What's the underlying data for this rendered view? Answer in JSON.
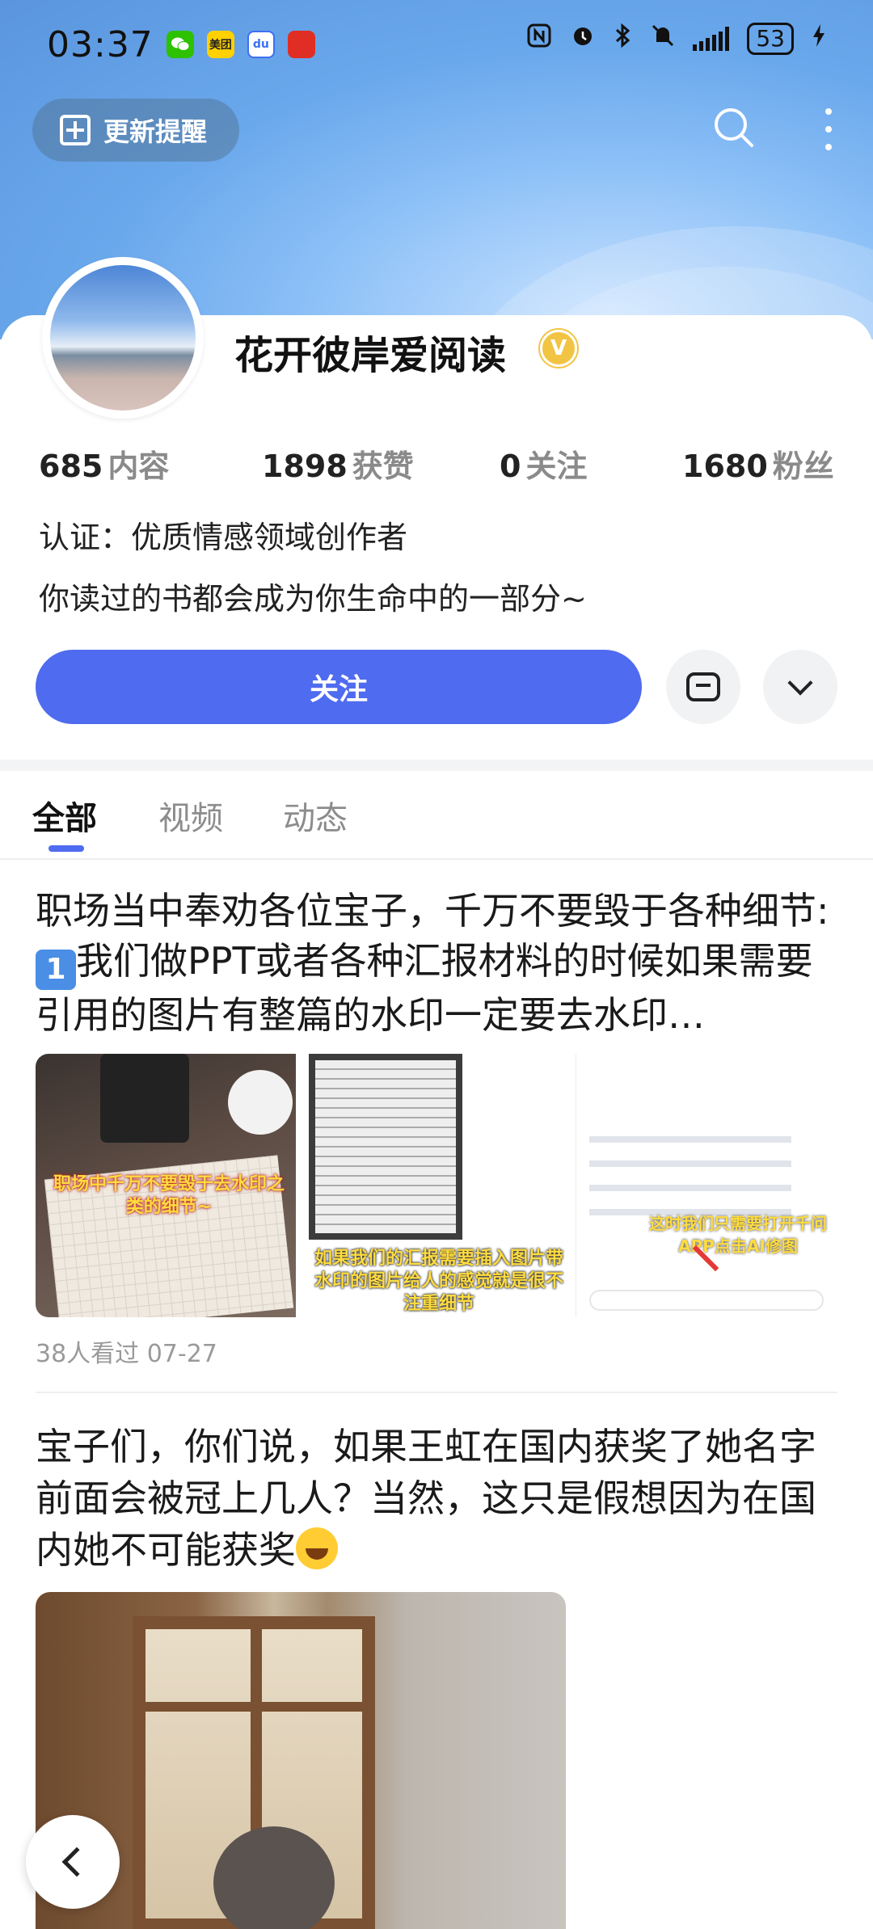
{
  "status_bar": {
    "time": "03:37",
    "app_icons": [
      {
        "name": "wechat-icon",
        "label": "",
        "color": "#2dc100"
      },
      {
        "name": "meituan-icon",
        "label": "美团",
        "color": "#ffd100"
      },
      {
        "name": "baidu-icon",
        "label": "du",
        "color": "#3b6ff5"
      },
      {
        "name": "pinduoduo-icon",
        "label": "",
        "color": "#e02e24"
      }
    ],
    "battery": "53"
  },
  "header": {
    "remind_label": "更新提醒"
  },
  "profile": {
    "name": "花开彼岸爱阅读",
    "verified_mark": "V",
    "stats": [
      {
        "value": "685",
        "label": "内容"
      },
      {
        "value": "1898",
        "label": "获赞"
      },
      {
        "value": "0",
        "label": "关注"
      },
      {
        "value": "1680",
        "label": "粉丝"
      }
    ],
    "certification": "认证：优质情感领域创作者",
    "bio": "你读过的书都会成为你生命中的一部分~",
    "follow_label": "关注"
  },
  "tabs": [
    {
      "label": "全部",
      "active": true
    },
    {
      "label": "视频",
      "active": false
    },
    {
      "label": "动态",
      "active": false
    }
  ],
  "posts": [
    {
      "title_before": "职场当中奉劝各位宝子，千万不要毁于各种细节:",
      "title_badge": "1",
      "title_after": "我们做PPT或者各种汇报材料的时候如果需要引用的图片有整篇的水印一定要去水印…",
      "thumb_captions": [
        "职场中千万不要毁于去水印之类的细节~",
        "如果我们的汇报需要插入图片带水印的图片给人的感觉就是很不注重细节",
        "这时我们只需要打开千问APP点击AI修图"
      ],
      "meta": "38人看过  07-27"
    },
    {
      "title": "宝子们，你们说，如果王虹在国内获奖了她名字前面会被冠上几人？当然，这只是假想因为在国内她不可能获奖"
    }
  ],
  "colors": {
    "accent": "#4f6bef",
    "verified": "#f2c443"
  }
}
